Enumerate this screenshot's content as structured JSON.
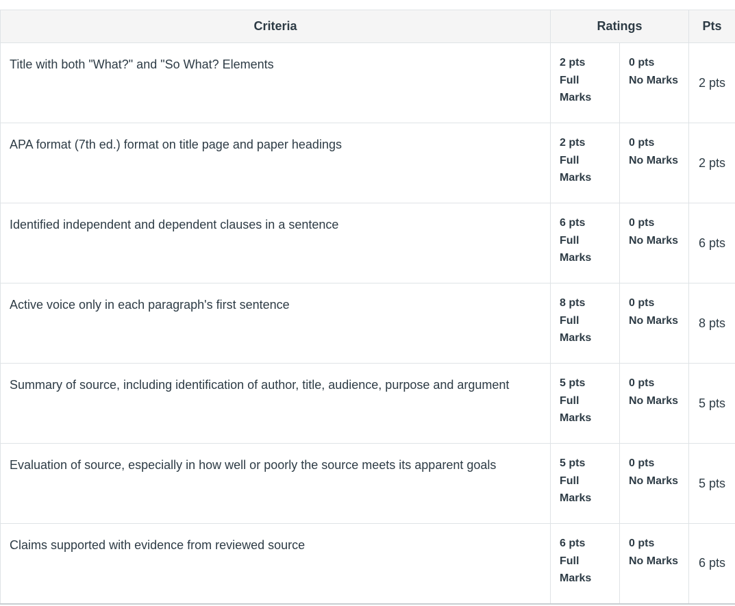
{
  "table": {
    "headers": {
      "criteria": "Criteria",
      "ratings": "Ratings",
      "pts": "Pts"
    },
    "rows": [
      {
        "criterion": "Title with both \"What?\" and \"So What? Elements",
        "ratings": [
          {
            "pts": "2 pts",
            "desc": "Full Marks"
          },
          {
            "pts": "0 pts",
            "desc": "No Marks"
          }
        ],
        "points": "2 pts"
      },
      {
        "criterion": "APA format (7th ed.) format on title page and paper headings",
        "ratings": [
          {
            "pts": "2 pts",
            "desc": "Full Marks"
          },
          {
            "pts": "0 pts",
            "desc": "No Marks"
          }
        ],
        "points": "2 pts"
      },
      {
        "criterion": "Identified independent and dependent clauses in a sentence",
        "ratings": [
          {
            "pts": "6 pts",
            "desc": "Full Marks"
          },
          {
            "pts": "0 pts",
            "desc": "No Marks"
          }
        ],
        "points": "6 pts"
      },
      {
        "criterion": "Active voice only in each paragraph's first sentence",
        "ratings": [
          {
            "pts": "8 pts",
            "desc": "Full Marks"
          },
          {
            "pts": "0 pts",
            "desc": "No Marks"
          }
        ],
        "points": "8 pts"
      },
      {
        "criterion": "Summary of source, including identification of author, title, audience, purpose and argument",
        "ratings": [
          {
            "pts": "5 pts",
            "desc": "Full Marks"
          },
          {
            "pts": "0 pts",
            "desc": "No Marks"
          }
        ],
        "points": "5 pts"
      },
      {
        "criterion": "Evaluation of source, especially in how well or poorly the source meets its apparent goals",
        "ratings": [
          {
            "pts": "5 pts",
            "desc": "Full Marks"
          },
          {
            "pts": "0 pts",
            "desc": "No Marks"
          }
        ],
        "points": "5 pts"
      },
      {
        "criterion": "Claims supported with evidence from reviewed source",
        "ratings": [
          {
            "pts": "6 pts",
            "desc": "Full Marks"
          },
          {
            "pts": "0 pts",
            "desc": "No Marks"
          }
        ],
        "points": "6 pts"
      }
    ]
  }
}
